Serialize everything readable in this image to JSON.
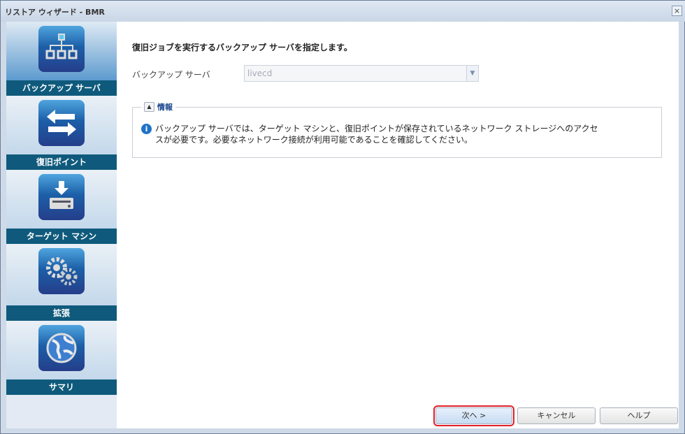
{
  "window": {
    "title": "リストア ウィザード - BMR",
    "close_icon": "×"
  },
  "sidebar": {
    "steps": [
      {
        "label": "バックアップ サーバ",
        "icon": "server-tree-icon",
        "active": true
      },
      {
        "label": "復旧ポイント",
        "icon": "arrows-exchange-icon"
      },
      {
        "label": "ターゲット マシン",
        "icon": "target-drive-icon"
      },
      {
        "label": "拡張",
        "icon": "gears-icon"
      },
      {
        "label": "サマリ",
        "icon": "globe-icon"
      }
    ]
  },
  "main": {
    "heading": "復旧ジョブを実行するバックアップ サーバを指定します。",
    "server_label": "バックアップ サーバ",
    "server_value": "livecd",
    "info": {
      "title": "情報",
      "toggle": "▲",
      "text": "バックアップ サーバでは、ターゲット マシンと、復旧ポイントが保存されているネットワーク ストレージへのアクセスが必要です。必要なネットワーク接続が利用可能であることを確認してください。"
    }
  },
  "buttons": {
    "next": "次へ >",
    "cancel": "キャンセル",
    "help": "ヘルプ"
  }
}
